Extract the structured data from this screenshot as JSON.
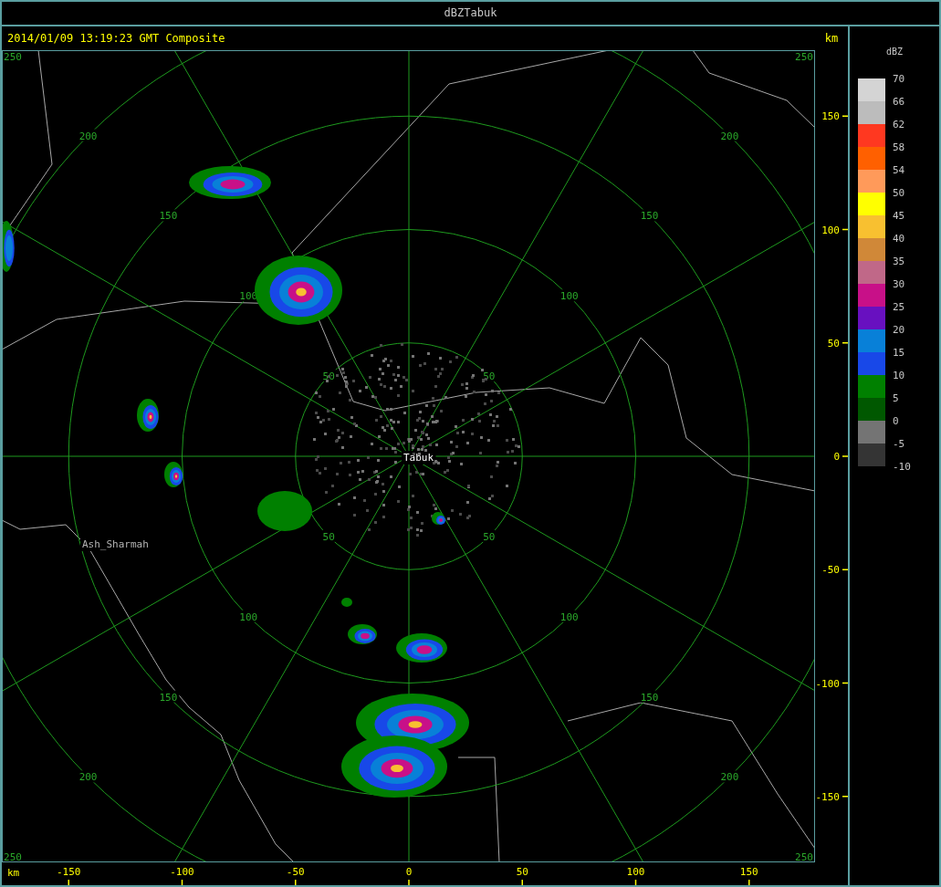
{
  "window": {
    "title": "dBZTabuk"
  },
  "header": {
    "timestamp": "2014/01/09 13:19:23 GMT Composite"
  },
  "map": {
    "range_rings": [
      {
        "labels": [
          "50",
          "50",
          "50",
          "50"
        ]
      },
      {
        "labels": [
          "100",
          "100",
          "100",
          "100"
        ]
      },
      {
        "labels": [
          "150",
          "150",
          "150",
          "150"
        ]
      },
      {
        "labels": [
          "200",
          "200",
          "200",
          "200"
        ]
      },
      {
        "labels": [
          "250",
          "250",
          "250",
          "250"
        ]
      }
    ],
    "places": [
      {
        "name": "Tabuk",
        "kind": "radar-site"
      },
      {
        "name": "Ash_Sharmah",
        "kind": "town"
      }
    ]
  },
  "y_axis": {
    "unit": "km",
    "ticks": [
      "150",
      "100",
      "50",
      "0",
      "-50",
      "-100",
      "-150"
    ]
  },
  "x_axis": {
    "unit": "km",
    "ticks": [
      "-150",
      "-100",
      "-50",
      "0",
      "50",
      "100",
      "150"
    ]
  },
  "legend": {
    "title": "dBZ",
    "bins": [
      {
        "color": "#d4d4d4"
      },
      {
        "color": "#bcbcbc"
      },
      {
        "color": "#ff3820"
      },
      {
        "color": "#ff6000"
      },
      {
        "color": "#ff9a5a"
      },
      {
        "color": "#ffff00"
      },
      {
        "color": "#f8c030"
      },
      {
        "color": "#d08838"
      },
      {
        "color": "#c06888"
      },
      {
        "color": "#c81088"
      },
      {
        "color": "#6810c0"
      },
      {
        "color": "#0880d8"
      },
      {
        "color": "#1848e8"
      },
      {
        "color": "#008000"
      },
      {
        "color": "#005800"
      },
      {
        "color": "#747474"
      },
      {
        "color": "#343434"
      }
    ],
    "labels": [
      "70",
      "66",
      "62",
      "58",
      "54",
      "50",
      "45",
      "40",
      "35",
      "30",
      "25",
      "20",
      "15",
      "10",
      "5",
      "0",
      "-5",
      "-10"
    ]
  }
}
